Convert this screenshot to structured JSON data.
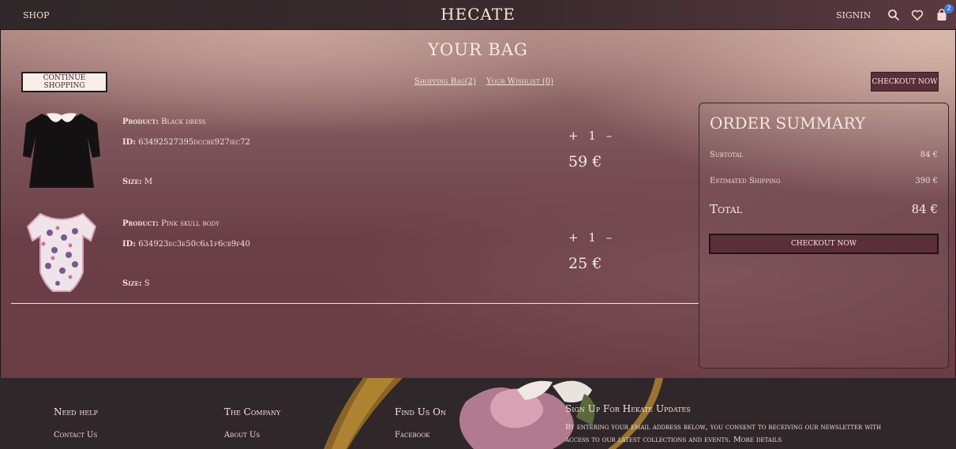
{
  "nav": {
    "shop": "SHOP",
    "brand": "HECATE",
    "signin": "SIGNIN",
    "cart_count": "2"
  },
  "page": {
    "title": "YOUR BAG",
    "continue_label": "CONTINUE SHOPPING",
    "shopping_bag_link": "Shopping Bag(2)",
    "wishlist_link": "Your Wishlist (0)",
    "checkout_top_label": "CHECKOUT NOW"
  },
  "products": [
    {
      "product_label": "Product:",
      "product_name": "Black dress",
      "id_label": "ID:",
      "id": "63492527395dccbe927iec72",
      "size_label": "Size:",
      "size": "M",
      "qty_plus": "+",
      "quantity": "1",
      "qty_minus": "–",
      "price": "59 €"
    },
    {
      "product_label": "Product:",
      "product_name": "Pink skull body",
      "id_label": "ID:",
      "id": "634923ec3e50c6a1f6cb9f40",
      "size_label": "Size:",
      "size": "S",
      "qty_plus": "+",
      "quantity": "1",
      "qty_minus": "–",
      "price": "25 €"
    }
  ],
  "summary": {
    "title": "ORDER SUMMARY",
    "subtotal_label": "Subtotal",
    "subtotal_value": "84 €",
    "shipping_label": "Estimated Shipping",
    "shipping_value": "390 €",
    "total_label": "Total",
    "total_value": "84 €",
    "checkout_label": "CHECKOUT NOW"
  },
  "footer": {
    "need_help_title": "Need help",
    "contact_link": "Contact Us",
    "company_title": "The Company",
    "about_link": "About Us",
    "find_title": "Find Us On",
    "facebook_link": "Facebook",
    "signup_title": "Sign Up For Hekate Updates",
    "signup_text": "By entering your email address below, you consent to receiving our newsletter with access to our latest collections and events. More details"
  },
  "colors": {
    "accent": "#5a2f39",
    "badge": "#3a7bd5"
  },
  "icons": [
    "search-icon",
    "heart-icon",
    "bag-icon"
  ]
}
